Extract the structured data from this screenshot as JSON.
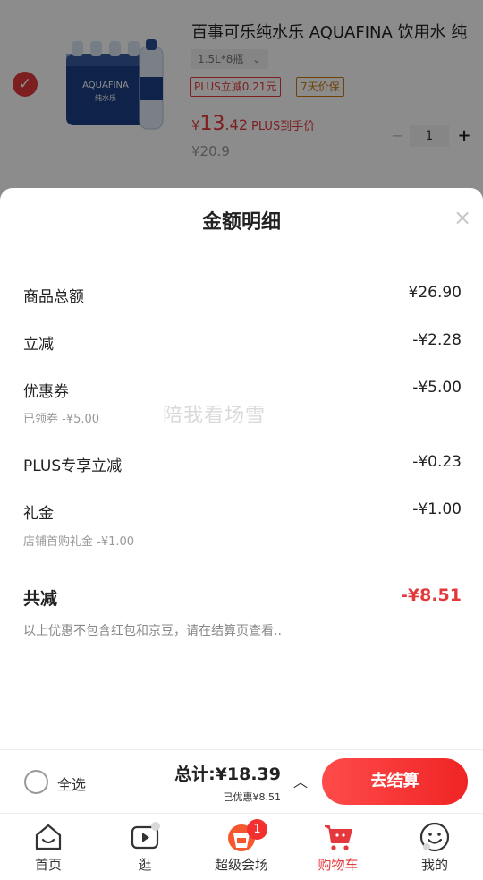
{
  "product": {
    "title": "百事可乐纯水乐 AQUAFINA 饮用水 纯",
    "spec": "1.5L*8瓶",
    "tags": [
      "PLUS立减0.21元",
      "7天价保"
    ],
    "price_symbol": "¥",
    "price_int": "13",
    "price_dec": ".42",
    "price_label": "PLUS到手价",
    "original_price": "¥20.9",
    "quantity": "1",
    "pack_brand": "AQUAFINA",
    "pack_sub": "纯水乐"
  },
  "sheet": {
    "title": "金额明细",
    "rows": [
      {
        "label": "商品总额",
        "value": "¥26.90"
      },
      {
        "label": "立减",
        "value": "-¥2.28"
      },
      {
        "label": "优惠券",
        "value": "-¥5.00",
        "sub": "已领券 -¥5.00"
      },
      {
        "label": "PLUS专享立减",
        "value": "-¥0.23"
      },
      {
        "label": "礼金",
        "value": "-¥1.00",
        "sub": "店铺首购礼金 -¥1.00"
      }
    ],
    "total": {
      "label": "共减",
      "value": "-¥8.51"
    },
    "note": "以上优惠不包含红包和京豆，请在结算页查看..",
    "watermark": "陪我看场雪"
  },
  "checkout": {
    "select_all": "全选",
    "total": "总计:¥18.39",
    "saved": "已优惠¥8.51",
    "pay": "去结算"
  },
  "tabs": [
    {
      "label": "首页",
      "icon": "home-icon"
    },
    {
      "label": "逛",
      "icon": "video-icon"
    },
    {
      "label": "超级会场",
      "icon": "super-venue-icon",
      "badge": "1"
    },
    {
      "label": "购物车",
      "icon": "cart-icon",
      "active": true
    },
    {
      "label": "我的",
      "icon": "profile-icon"
    }
  ],
  "colors": {
    "accent": "#e4393c",
    "tag_gold": "#c8780d"
  }
}
